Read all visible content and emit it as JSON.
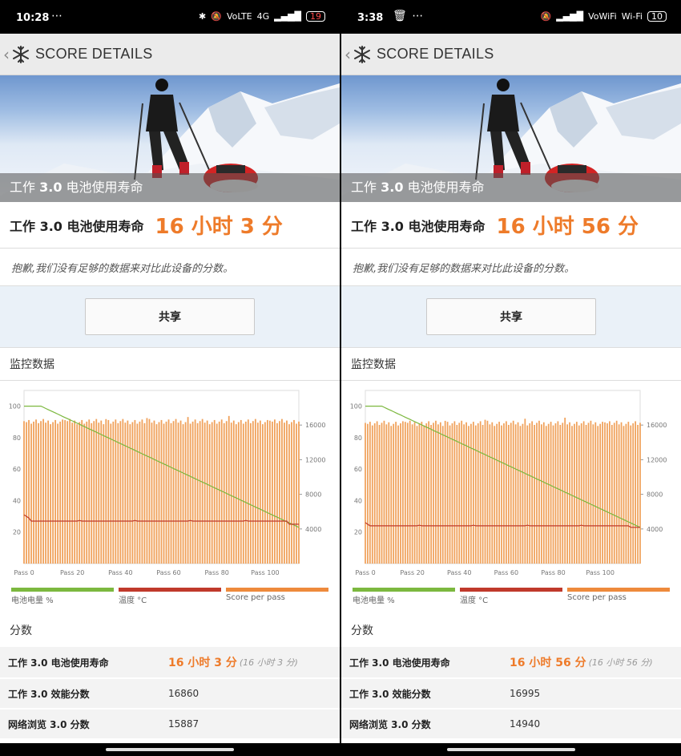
{
  "panels": [
    {
      "status": {
        "time": "10:28",
        "extra": "⋯",
        "icons": [
          "✱",
          "🔕",
          "VoLTE",
          "4G",
          "▂▄▆█"
        ],
        "battery": "19"
      },
      "header": {
        "title": "SCORE DETAILS"
      },
      "hero": {
        "caption_a": "工作",
        "caption_num": "3.0",
        "caption_b": "电池使用寿命"
      },
      "result": {
        "label": "工作 3.0 电池使用寿命",
        "value": "16 小时 3 分"
      },
      "apology": "抱歉,我们没有足够的数据来对比此设备的分数。",
      "share_label": "共享",
      "monitor_title": "监控数据",
      "scores_title": "分数",
      "scores": [
        {
          "name": "工作 3.0 电池使用寿命",
          "value": "16 小时 3 分",
          "sub": "(16 小时 3 分)"
        },
        {
          "name": "工作 3.0 效能分数",
          "value": "16860",
          "sub": ""
        },
        {
          "name": "网络浏览 3.0 分数",
          "value": "15887",
          "sub": ""
        }
      ],
      "chart_data": {
        "type": "bar",
        "x_ticks": [
          "Pass 0",
          "Pass 20",
          "Pass 40",
          "Pass 60",
          "Pass 80",
          "Pass 100"
        ],
        "y_left_ticks": [
          "100",
          "80",
          "60",
          "40",
          "20"
        ],
        "y_right_ticks": [
          "16000",
          "12000",
          "8000",
          "4000"
        ],
        "passes": 115,
        "score_level": 16400,
        "battery": {
          "start": 100,
          "end": 23
        },
        "temperature": {
          "start": 31,
          "steady": 27,
          "end": 25
        },
        "legend": [
          "电池电量 %",
          "温度 °C",
          "Score per pass"
        ]
      }
    },
    {
      "status": {
        "time": "3:38",
        "extra": "🗑 ⋯",
        "icons": [
          "🔕",
          "▂▄▆█",
          "VoWiFi",
          "Wi-Fi"
        ],
        "battery": "10"
      },
      "header": {
        "title": "SCORE DETAILS"
      },
      "hero": {
        "caption_a": "工作",
        "caption_num": "3.0",
        "caption_b": "电池使用寿命"
      },
      "result": {
        "label": "工作 3.0 电池使用寿命",
        "value": "16 小时 56 分"
      },
      "apology": "抱歉,我们没有足够的数据来对比此设备的分数。",
      "share_label": "共享",
      "monitor_title": "监控数据",
      "scores_title": "分数",
      "scores": [
        {
          "name": "工作 3.0 电池使用寿命",
          "value": "16 小时 56 分",
          "sub": "(16 小时 56 分)"
        },
        {
          "name": "工作 3.0 效能分数",
          "value": "16995",
          "sub": ""
        },
        {
          "name": "网络浏览 3.0 分数",
          "value": "14940",
          "sub": ""
        }
      ],
      "chart_data": {
        "type": "bar",
        "x_ticks": [
          "Pass 0",
          "Pass 20",
          "Pass 40",
          "Pass 60",
          "Pass 80",
          "Pass 100"
        ],
        "y_left_ticks": [
          "100",
          "80",
          "60",
          "40",
          "20"
        ],
        "y_right_ticks": [
          "16000",
          "12000",
          "8000",
          "4000"
        ],
        "passes": 118,
        "score_level": 16200,
        "battery": {
          "start": 100,
          "end": 23
        },
        "temperature": {
          "start": 26,
          "steady": 24,
          "end": 23
        },
        "legend": [
          "电池电量 %",
          "温度 °C",
          "Score per pass"
        ]
      }
    }
  ],
  "colors": {
    "accent": "#ee7b2a",
    "battery_line": "#7cb83f",
    "temp_line": "#c0392b",
    "bars": "#f0a15a"
  },
  "icons": {
    "back": "chevron-left-icon",
    "logo": "snowflake-icon"
  }
}
